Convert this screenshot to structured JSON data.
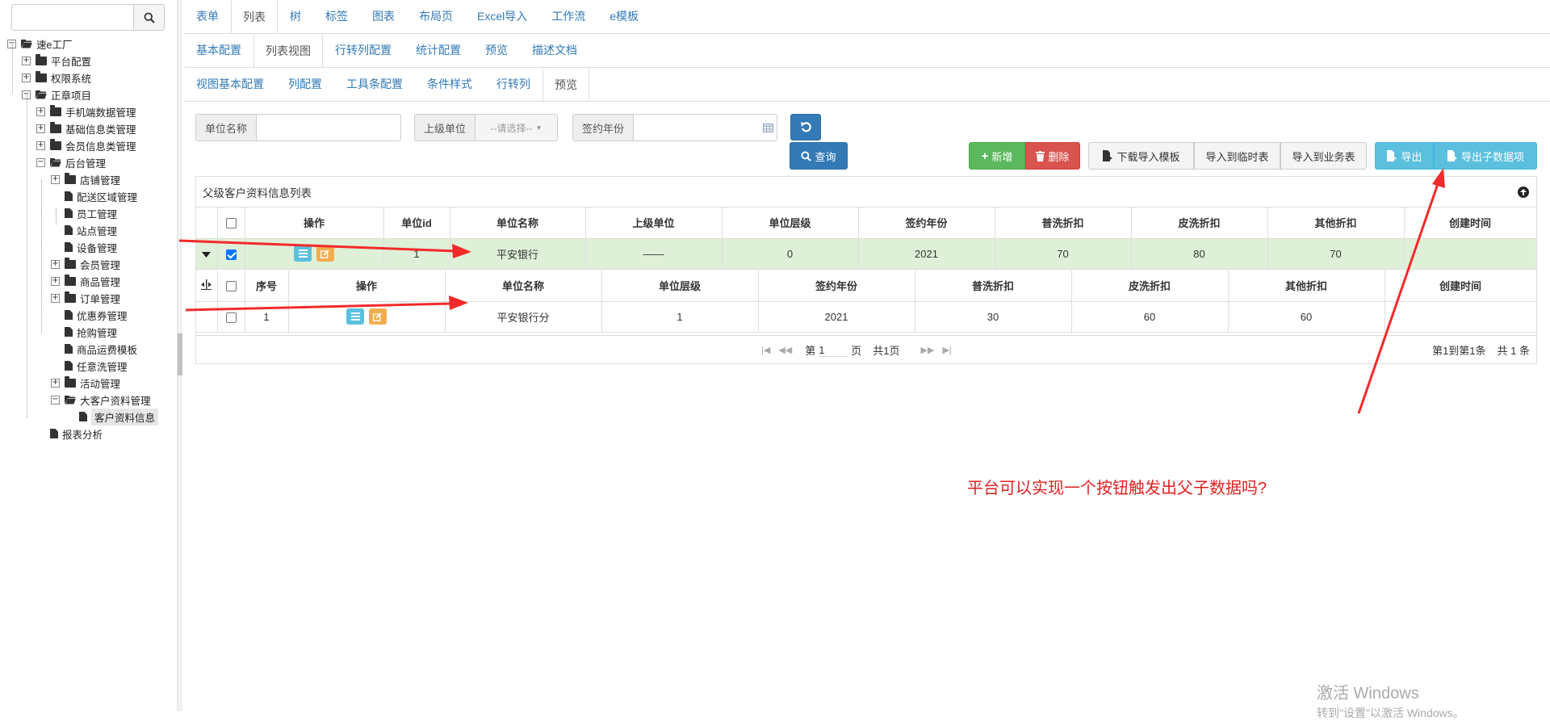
{
  "sidebar": {
    "search_placeholder": "",
    "tree": [
      {
        "label": "速e工厂",
        "level": 0,
        "toggle": "−",
        "icon": "folder-open"
      },
      {
        "label": "平台配置",
        "level": 1,
        "toggle": "+",
        "icon": "folder"
      },
      {
        "label": "权限系统",
        "level": 1,
        "toggle": "+",
        "icon": "folder"
      },
      {
        "label": "正章项目",
        "level": 1,
        "toggle": "−",
        "icon": "folder-open"
      },
      {
        "label": "手机端数据管理",
        "level": 2,
        "toggle": "+",
        "icon": "folder"
      },
      {
        "label": "基础信息类管理",
        "level": 2,
        "toggle": "+",
        "icon": "folder"
      },
      {
        "label": "会员信息类管理",
        "level": 2,
        "toggle": "+",
        "icon": "folder"
      },
      {
        "label": "后台管理",
        "level": 2,
        "toggle": "−",
        "icon": "folder-open"
      },
      {
        "label": "店铺管理",
        "level": 3,
        "toggle": "+",
        "icon": "folder"
      },
      {
        "label": "配送区域管理",
        "level": 3,
        "toggle": "",
        "icon": "file"
      },
      {
        "label": "员工管理",
        "level": 3,
        "toggle": "",
        "icon": "file"
      },
      {
        "label": "站点管理",
        "level": 3,
        "toggle": "",
        "icon": "file"
      },
      {
        "label": "设备管理",
        "level": 3,
        "toggle": "",
        "icon": "file"
      },
      {
        "label": "会员管理",
        "level": 3,
        "toggle": "+",
        "icon": "folder"
      },
      {
        "label": "商品管理",
        "level": 3,
        "toggle": "+",
        "icon": "folder"
      },
      {
        "label": "订单管理",
        "level": 3,
        "toggle": "+",
        "icon": "folder"
      },
      {
        "label": "优惠券管理",
        "level": 3,
        "toggle": "",
        "icon": "file"
      },
      {
        "label": "抢购管理",
        "level": 3,
        "toggle": "",
        "icon": "file"
      },
      {
        "label": "商品运费模板",
        "level": 3,
        "toggle": "",
        "icon": "file"
      },
      {
        "label": "任意洗管理",
        "level": 3,
        "toggle": "",
        "icon": "file"
      },
      {
        "label": "活动管理",
        "level": 3,
        "toggle": "+",
        "icon": "folder"
      },
      {
        "label": "大客户资料管理",
        "level": 3,
        "toggle": "−",
        "icon": "folder-open"
      },
      {
        "label": "客户资料信息",
        "level": 4,
        "toggle": "",
        "icon": "file",
        "selected": true
      },
      {
        "label": "报表分析",
        "level": 2,
        "toggle": "",
        "icon": "file"
      }
    ]
  },
  "tabs1": [
    "表单",
    "列表",
    "树",
    "标签",
    "图表",
    "布局页",
    "Excel导入",
    "工作流",
    "e模板"
  ],
  "tabs2": [
    "基本配置",
    "列表视图",
    "行转列配置",
    "统计配置",
    "预览",
    "描述文档"
  ],
  "tabs3": [
    "视图基本配置",
    "列配置",
    "工具条配置",
    "条件样式",
    "行转列",
    "预览"
  ],
  "filters": {
    "unit_name_label": "单位名称",
    "parent_unit_label": "上级单位",
    "parent_unit_value": "--请选择--",
    "year_label": "签约年份"
  },
  "buttons": {
    "query": "查询",
    "add": "新增",
    "delete": "删除",
    "download_template": "下载导入模板",
    "import_temp": "导入到临时表",
    "import_business": "导入到业务表",
    "export": "导出",
    "export_children": "导出子数据项"
  },
  "grid": {
    "title": "父级客户资料信息列表",
    "columns": [
      "操作",
      "单位id",
      "单位名称",
      "上级单位",
      "单位层级",
      "签约年份",
      "普洗折扣",
      "皮洗折扣",
      "其他折扣",
      "创建时间"
    ],
    "row": {
      "unit_id": "1",
      "unit_name": "平安银行",
      "parent": "——",
      "level": "0",
      "year": "2021",
      "pu": "70",
      "pi": "80",
      "other": "70",
      "created": ""
    },
    "child_columns": [
      "序号",
      "操作",
      "单位名称",
      "单位层级",
      "签约年份",
      "普洗折扣",
      "皮洗折扣",
      "其他折扣",
      "创建时间"
    ],
    "child_row": {
      "seq": "1",
      "unit_name": "平安银行分",
      "level": "1",
      "year": "2021",
      "pu": "30",
      "pi": "60",
      "other": "60",
      "created": ""
    },
    "pager": {
      "page_prefix": "第",
      "page_value": "1",
      "page_suffix": "页",
      "total_pages": "共1页",
      "summary": "第1到第1条",
      "total": "共 1 条"
    }
  },
  "annotation": "平台可以实现一个按钮触发出父子数据吗?",
  "watermark": {
    "line1": "激活 Windows",
    "line2": "转到\"设置\"以激活 Windows。"
  },
  "colors": {
    "arrow": "#f22a2a",
    "row_selected": "#dff0d8",
    "annotation": "#e02020"
  }
}
